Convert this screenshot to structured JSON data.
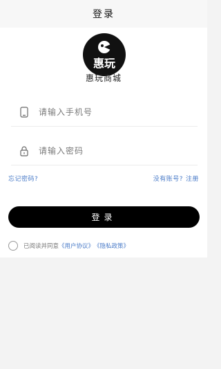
{
  "navbar": {
    "title": "登录"
  },
  "brand": {
    "logo_text": "惠玩",
    "name": "惠玩商城"
  },
  "form": {
    "phone_placeholder": "请输入手机号",
    "password_placeholder": "请输入密码",
    "forgot_label": "忘记密码?",
    "no_account_label": "没有账号?",
    "register_label": "注册",
    "login_label": "登录"
  },
  "agreement": {
    "prefix": "已阅读并同意",
    "user_agreement": "《用户协议》",
    "privacy_policy": "《隐私政策》"
  },
  "colors": {
    "accent_link": "#4a7bc8",
    "button": "#000000",
    "background": "#f3f3f3"
  },
  "icons": {
    "phone": "phone-icon",
    "lock": "lock-icon"
  }
}
